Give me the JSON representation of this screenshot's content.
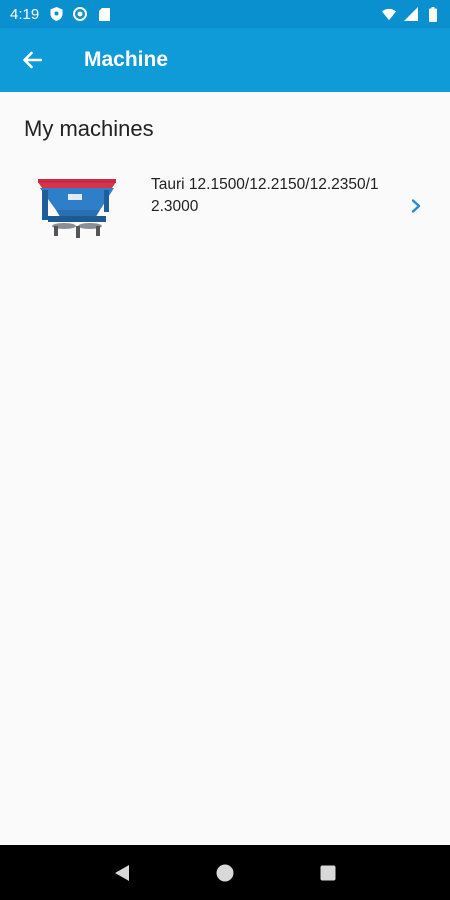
{
  "status_bar": {
    "time": "4:19",
    "icons": [
      "shield-icon",
      "sync-icon",
      "sd-card-icon",
      "wifi-icon",
      "signal-icon",
      "battery-icon"
    ]
  },
  "app_bar": {
    "title": "Machine",
    "back_icon": "arrow-back-icon",
    "color": "#0f9ad8"
  },
  "main": {
    "section_title": "My machines",
    "machines": [
      {
        "name": "Tauri 12.1500/12.2150/12.2350/12.3000",
        "image": "spreader-image",
        "chevron_icon": "chevron-right-icon"
      }
    ]
  },
  "nav_bar": {
    "buttons": [
      "back-triangle-icon",
      "home-circle-icon",
      "recents-square-icon"
    ]
  }
}
